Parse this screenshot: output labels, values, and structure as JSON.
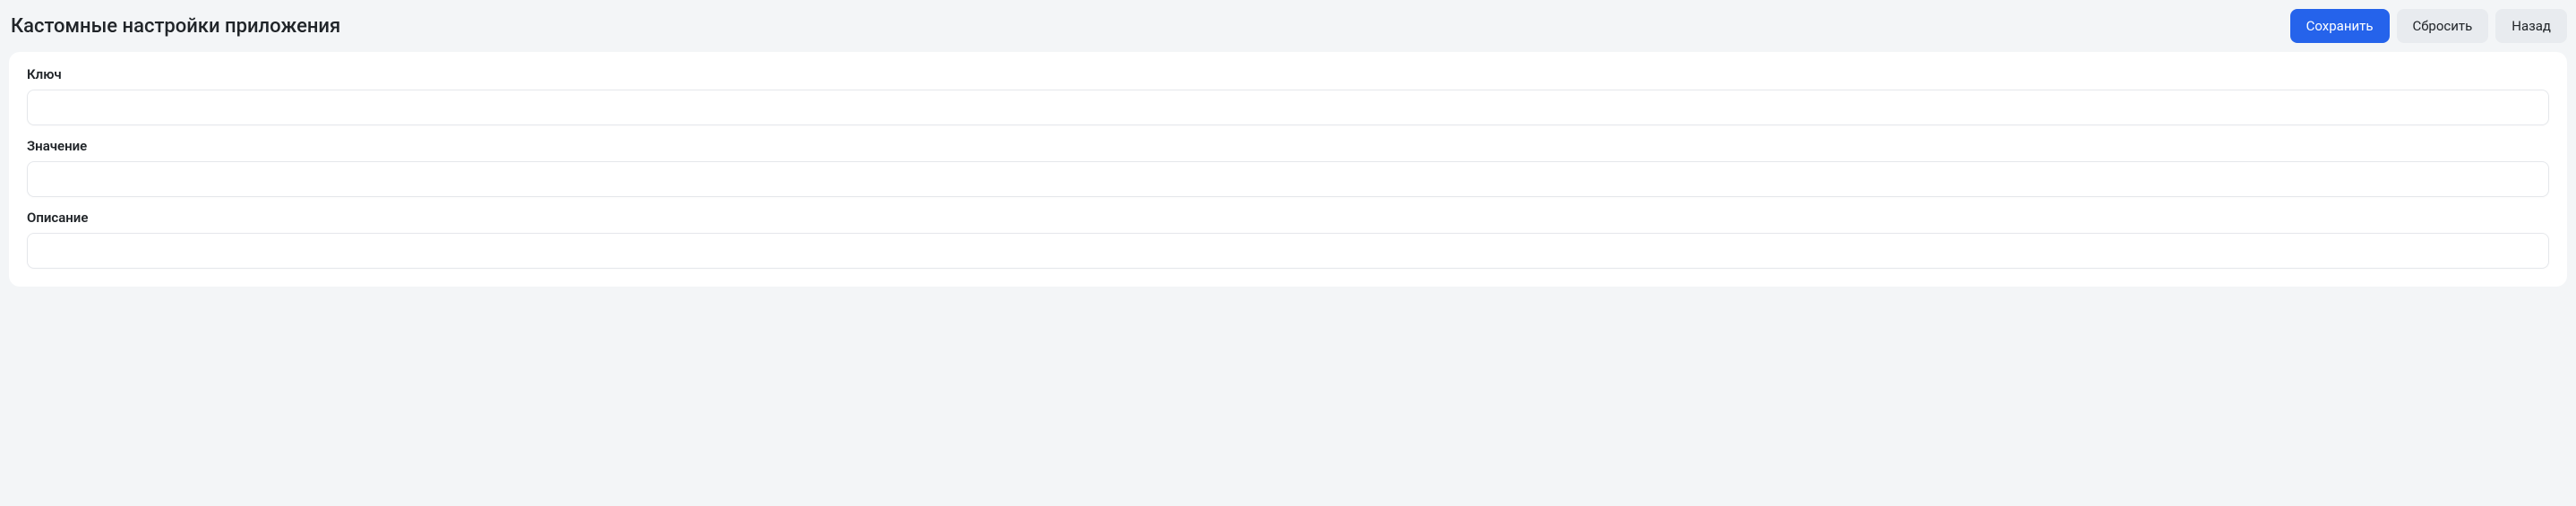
{
  "header": {
    "title": "Кастомные настройки приложения",
    "buttons": {
      "save": "Сохранить",
      "reset": "Сбросить",
      "back": "Назад"
    }
  },
  "form": {
    "fields": {
      "key": {
        "label": "Ключ",
        "value": ""
      },
      "value": {
        "label": "Значение",
        "value": ""
      },
      "description": {
        "label": "Описание",
        "value": ""
      }
    }
  }
}
